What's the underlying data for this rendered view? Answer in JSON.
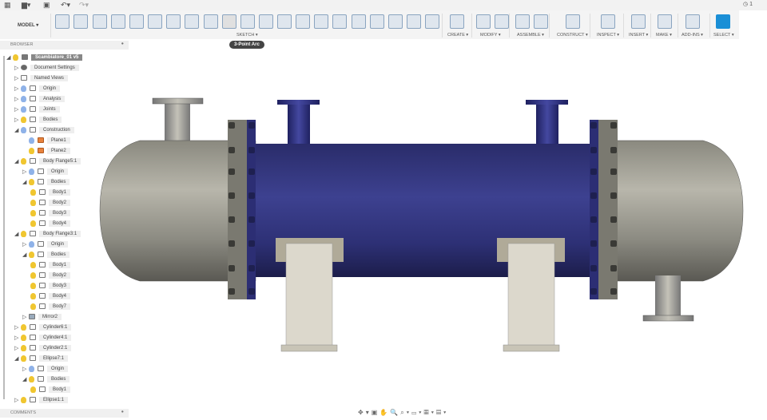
{
  "topbar": {
    "grid_icon": "app-grid-icon",
    "file_icon": "file-icon",
    "save_icon": "save-icon",
    "undo_icon": "undo-icon",
    "redo_icon": "redo-icon",
    "job_status": "1"
  },
  "ribbon": {
    "workspace": "MODEL ▾",
    "groups": [
      "SKETCH ▾",
      "CREATE ▾",
      "MODIFY ▾",
      "ASSEMBLE ▾",
      "CONSTRUCT ▾",
      "INSPECT ▾",
      "INSERT ▾",
      "MAKE ▾",
      "ADD-INS ▾",
      "SELECT ▾"
    ],
    "accent": "#1b8fd6"
  },
  "tooltip": "3-Point Arc",
  "browser": {
    "title": "BROWSER",
    "rows": [
      {
        "label": "Scambiatore_01 v5",
        "level": 0,
        "toggle": "open",
        "bulb": "yellow",
        "icon": "doc"
      },
      {
        "label": "Document Settings",
        "level": 1,
        "toggle": "closed",
        "bulb": "",
        "icon": "gear"
      },
      {
        "label": "Named Views",
        "level": 1,
        "toggle": "closed",
        "bulb": "",
        "icon": "folder"
      },
      {
        "label": "Origin",
        "level": 1,
        "toggle": "closed",
        "bulb": "blue",
        "icon": "folder"
      },
      {
        "label": "Analysis",
        "level": 1,
        "toggle": "closed",
        "bulb": "blue",
        "icon": "folder"
      },
      {
        "label": "Joints",
        "level": 1,
        "toggle": "closed",
        "bulb": "blue",
        "icon": "folder"
      },
      {
        "label": "Bodies",
        "level": 1,
        "toggle": "closed",
        "bulb": "yellow",
        "icon": "folder"
      },
      {
        "label": "Construction",
        "level": 1,
        "toggle": "open",
        "bulb": "blue",
        "icon": "folder"
      },
      {
        "label": "Plane1",
        "level": 2,
        "toggle": "",
        "bulb": "blue",
        "icon": "plane"
      },
      {
        "label": "Plane2",
        "level": 2,
        "toggle": "",
        "bulb": "yellow",
        "icon": "plane"
      },
      {
        "label": "Body Flange5:1",
        "level": 1,
        "toggle": "open",
        "bulb": "yellow",
        "icon": "component"
      },
      {
        "label": "Origin",
        "level": 2,
        "toggle": "closed",
        "bulb": "blue",
        "icon": "folder"
      },
      {
        "label": "Bodies",
        "level": 2,
        "toggle": "open",
        "bulb": "yellow",
        "icon": "folder"
      },
      {
        "label": "Body1",
        "level": 3,
        "toggle": "",
        "bulb": "yellow",
        "icon": "body"
      },
      {
        "label": "Body2",
        "level": 3,
        "toggle": "",
        "bulb": "yellow",
        "icon": "body"
      },
      {
        "label": "Body3",
        "level": 3,
        "toggle": "",
        "bulb": "yellow",
        "icon": "body"
      },
      {
        "label": "Body4",
        "level": 3,
        "toggle": "",
        "bulb": "yellow",
        "icon": "body"
      },
      {
        "label": "Body Flange3:1",
        "level": 1,
        "toggle": "open",
        "bulb": "yellow",
        "icon": "component"
      },
      {
        "label": "Origin",
        "level": 2,
        "toggle": "closed",
        "bulb": "blue",
        "icon": "folder"
      },
      {
        "label": "Bodies",
        "level": 2,
        "toggle": "open",
        "bulb": "yellow",
        "icon": "folder"
      },
      {
        "label": "Body1",
        "level": 3,
        "toggle": "",
        "bulb": "yellow",
        "icon": "body"
      },
      {
        "label": "Body2",
        "level": 3,
        "toggle": "",
        "bulb": "yellow",
        "icon": "body"
      },
      {
        "label": "Body3",
        "level": 3,
        "toggle": "",
        "bulb": "yellow",
        "icon": "body"
      },
      {
        "label": "Body4",
        "level": 3,
        "toggle": "",
        "bulb": "yellow",
        "icon": "body"
      },
      {
        "label": "Body7",
        "level": 3,
        "toggle": "",
        "bulb": "yellow",
        "icon": "body"
      },
      {
        "label": "Mirror2",
        "level": 2,
        "toggle": "closed",
        "bulb": "",
        "icon": "mirror"
      },
      {
        "label": "Cylinder6:1",
        "level": 1,
        "toggle": "closed",
        "bulb": "yellow",
        "icon": "component"
      },
      {
        "label": "Cylinder4:1",
        "level": 1,
        "toggle": "closed",
        "bulb": "yellow",
        "icon": "component"
      },
      {
        "label": "Cylinder2:1",
        "level": 1,
        "toggle": "closed",
        "bulb": "yellow",
        "icon": "component"
      },
      {
        "label": "Ellipse7:1",
        "level": 1,
        "toggle": "open",
        "bulb": "yellow",
        "icon": "component"
      },
      {
        "label": "Origin",
        "level": 2,
        "toggle": "closed",
        "bulb": "blue",
        "icon": "folder"
      },
      {
        "label": "Bodies",
        "level": 2,
        "toggle": "open",
        "bulb": "yellow",
        "icon": "folder"
      },
      {
        "label": "Body1",
        "level": 3,
        "toggle": "",
        "bulb": "yellow",
        "icon": "body"
      },
      {
        "label": "Ellipse1:1",
        "level": 1,
        "toggle": "closed",
        "bulb": "yellow",
        "icon": "component"
      }
    ]
  },
  "comments": {
    "title": "COMMENTS"
  },
  "navbar": {
    "icons": [
      "orbit-icon",
      "look-at-icon",
      "pan-icon",
      "zoom-icon",
      "fit-icon",
      "display-mode-icon",
      "grid-icon",
      "viewports-icon"
    ]
  }
}
